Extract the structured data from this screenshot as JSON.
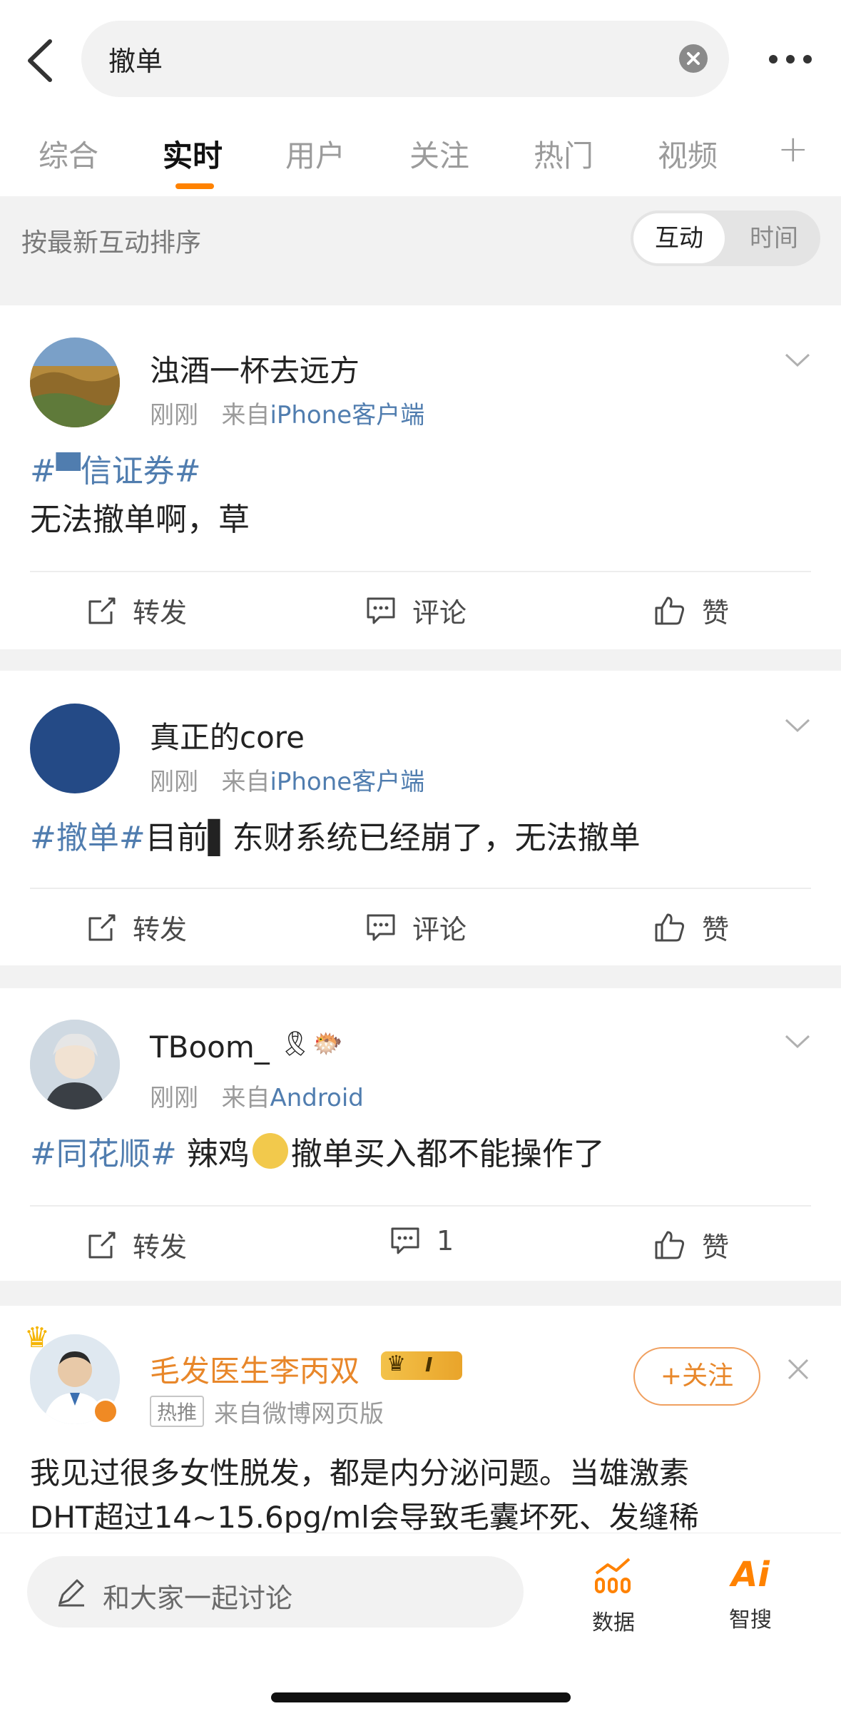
{
  "search": {
    "query": "撤单"
  },
  "tabs": [
    "综合",
    "实时",
    "用户",
    "关注",
    "热门",
    "视频"
  ],
  "sort": {
    "label": "按最新互动排序",
    "options": [
      "互动",
      "时间"
    ]
  },
  "posts": [
    {
      "user": "浊酒一杯去远方",
      "time": "刚刚",
      "from_prefix": "来自",
      "source": "iPhone客户端",
      "tag": "#▀信证券#",
      "text": "无法撤单啊，草",
      "actions": {
        "repost": "转发",
        "comment": "评论",
        "like": "赞"
      }
    },
    {
      "user": "真正的core",
      "time": "刚刚",
      "from_prefix": "来自",
      "source": "iPhone客户端",
      "tag": "#撤单#",
      "text": "目前▌东财系统已经崩了，无法撤单",
      "actions": {
        "repost": "转发",
        "comment": "评论",
        "like": "赞"
      }
    },
    {
      "user": "TBoom_",
      "time": "刚刚",
      "from_prefix": "来自",
      "source": "Android",
      "tag": "#同花顺#",
      "text_a": " 辣鸡",
      "text_b": "撤单买入都不能操作了",
      "actions": {
        "repost": "转发",
        "comment": "1",
        "like": "赞"
      }
    },
    {
      "user": "毛发医生李丙双",
      "badge": "热推",
      "from_prefix": "来自",
      "source": "微博网页版",
      "follow": "+关注",
      "level": "I",
      "text_line1": "我见过很多女性脱发，都是内分泌问题。当雄激素",
      "text_line2": "DHT超过14~15.6pg/ml会导致毛囊坏死、发缝稀"
    }
  ],
  "bottom": {
    "placeholder": "和大家一起讨论",
    "data_label": "数据",
    "ai_label": "智搜"
  },
  "colors": {
    "accent": "#ff8200",
    "link": "#507daf",
    "vip_name": "#e8872a"
  }
}
